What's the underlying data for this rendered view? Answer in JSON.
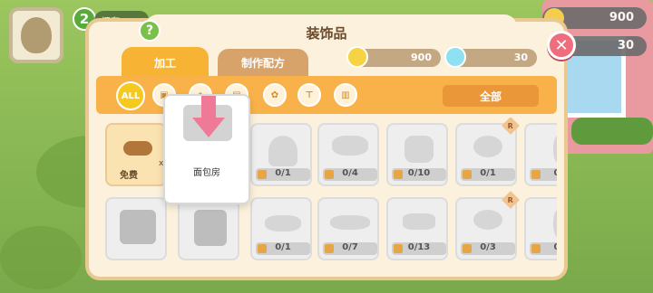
{
  "hud": {
    "level": "2",
    "status_text": "还有",
    "status_text2": "橋"
  },
  "bg_currency": {
    "coins": "900",
    "gems": "30"
  },
  "panel": {
    "title": "装饰品",
    "help_icon": "?",
    "close_icon": "✕",
    "tabs": [
      {
        "label": "加工",
        "active": true
      },
      {
        "label": "制作配方",
        "active": false
      }
    ],
    "currency": {
      "coins": "900",
      "gems": "30"
    },
    "filters": {
      "all_label": "ALL",
      "icons": [
        "item-icon",
        "house-icon",
        "fence-icon",
        "flower-icon",
        "table-icon",
        "wall-icon"
      ],
      "dropdown_label": "全部"
    }
  },
  "popup": {
    "name": "面包房"
  },
  "cards_row1": [
    {
      "type": "free",
      "label": "免费",
      "qty": "x2"
    },
    {
      "count": "0/1",
      "rare": false
    },
    {
      "count": "0/4",
      "rare": false
    },
    {
      "count": "0/10",
      "rare": false
    },
    {
      "count": "0/1",
      "rare": true
    },
    {
      "count": "0",
      "rare": true
    }
  ],
  "cards_row2": [
    {
      "type": "house"
    },
    {
      "type": "house"
    },
    {
      "count": "0/1",
      "rare": false
    },
    {
      "count": "0/7",
      "rare": false
    },
    {
      "count": "0/13",
      "rare": false
    },
    {
      "count": "0/3",
      "rare": true
    },
    {
      "count": "0",
      "rare": true
    }
  ],
  "colors": {
    "panel_bg": "#fbf1dc",
    "tab_active": "#f7b333",
    "filter_bar": "#f9b24a",
    "close": "#ef6d7c",
    "help": "#7cc04c"
  }
}
